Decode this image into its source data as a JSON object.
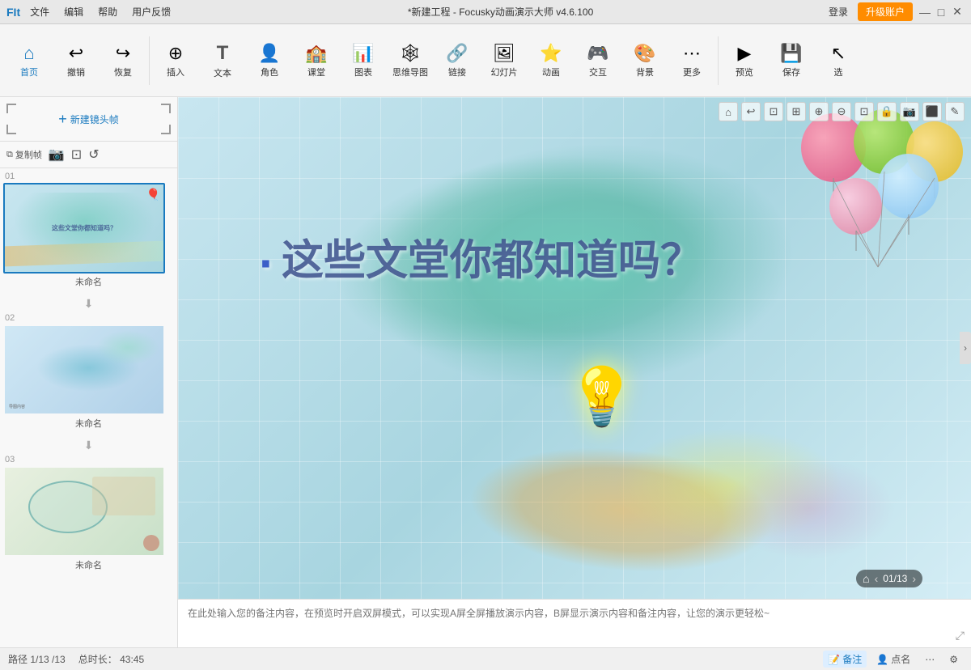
{
  "titlebar": {
    "app_icon": "FIt",
    "menus": [
      "文件",
      "编辑",
      "帮助",
      "用户反馈"
    ],
    "title": "*新建工程 - Focusky动画演示大师  v4.6.100",
    "login_label": "登录",
    "upgrade_label": "升级账户",
    "min_btn": "—",
    "max_btn": "□",
    "close_btn": "✕"
  },
  "toolbar": {
    "items": [
      {
        "id": "home",
        "icon": "🏠",
        "label": "首页"
      },
      {
        "id": "undo",
        "icon": "↩",
        "label": "撤销"
      },
      {
        "id": "redo",
        "icon": "↪",
        "label": "恢复"
      },
      {
        "id": "insert",
        "icon": "➕",
        "label": "插入"
      },
      {
        "id": "text",
        "icon": "T",
        "label": "文本"
      },
      {
        "id": "role",
        "icon": "👤",
        "label": "角色"
      },
      {
        "id": "class",
        "icon": "🏫",
        "label": "课堂"
      },
      {
        "id": "chart",
        "icon": "📊",
        "label": "图表"
      },
      {
        "id": "mindmap",
        "icon": "🕸",
        "label": "思维导图"
      },
      {
        "id": "link",
        "icon": "🔗",
        "label": "链接"
      },
      {
        "id": "slide",
        "icon": "🖼",
        "label": "幻灯片"
      },
      {
        "id": "anim",
        "icon": "✨",
        "label": "动画"
      },
      {
        "id": "interact",
        "icon": "🎮",
        "label": "交互"
      },
      {
        "id": "bg",
        "icon": "🎨",
        "label": "背景"
      },
      {
        "id": "more",
        "icon": "⋯",
        "label": "更多"
      },
      {
        "id": "preview",
        "icon": "▶",
        "label": "预览"
      },
      {
        "id": "save",
        "icon": "💾",
        "label": "保存"
      },
      {
        "id": "select",
        "icon": "↖",
        "label": "选"
      }
    ]
  },
  "sidebar": {
    "new_frame_label": "新建镜头帧",
    "tools": [
      "复制帧",
      "📷",
      "⊡",
      "↺"
    ],
    "slides": [
      {
        "number": "01",
        "name": "未命名",
        "active": true
      },
      {
        "number": "02",
        "name": "未命名",
        "active": false
      },
      {
        "number": "03",
        "name": "未命名",
        "active": false
      }
    ]
  },
  "canvas": {
    "main_text": "这些文堂你都知道吗？",
    "bullet": "·",
    "toolbar_icons": [
      "🏠",
      "↩",
      "⊡",
      "⊞",
      "⊟",
      "⊡",
      "🔒",
      "📷",
      "⊡",
      "✏"
    ]
  },
  "page_counter": {
    "current": "01",
    "total": "13",
    "text": "01/13"
  },
  "notes": {
    "placeholder": "在此处输入您的备注内容，在预览时开启双屏模式，可以实现A屏全屏播放演示内容，B屏显示演示内容和备注内容，让您的演示更轻松~"
  },
  "statusbar": {
    "path_label": "路径",
    "path_value": "1/13",
    "duration_label": "总时长：",
    "duration_value": "43:45",
    "notes_btn": "备注",
    "points_btn": "点名",
    "more_icon": "⋯"
  },
  "icons": {
    "chevron_left": "‹",
    "chevron_right": "›",
    "chevron_down": "˅",
    "expand": "⤢",
    "home": "⌂",
    "undo": "↩",
    "redo": "↪",
    "copy": "⧉",
    "camera": "📷",
    "frame": "⊡",
    "rotate": "↺",
    "zoom_in": "⊕",
    "zoom_out": "⊖",
    "lock": "🔒",
    "edit": "✎",
    "shield": "🛡",
    "save_icon": "💾"
  }
}
